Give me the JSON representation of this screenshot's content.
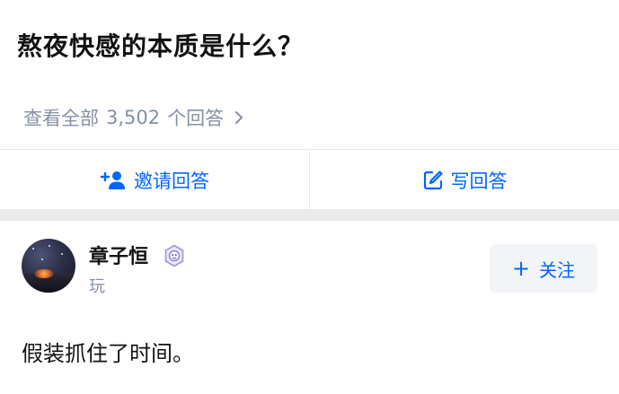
{
  "question": {
    "title": "熬夜快感的本质是什么？",
    "view_all_prefix": "查看全部",
    "answer_count": "3,502",
    "view_all_suffix": "个回答"
  },
  "actions": {
    "invite_label": "邀请回答",
    "write_label": "写回答"
  },
  "answer": {
    "author_name": "章子恒",
    "author_bio": "玩",
    "follow_label": "关注",
    "excerpt": "假装抓住了时间。"
  },
  "icons": {
    "invite": "add-user-icon",
    "write": "edit-icon",
    "chevron": "chevron-right-icon",
    "badge": "badge-icon",
    "plus": "plus-icon"
  },
  "colors": {
    "accent": "#0066ff",
    "muted": "#8590a6",
    "divider": "#ebebeb",
    "text": "#121212"
  }
}
